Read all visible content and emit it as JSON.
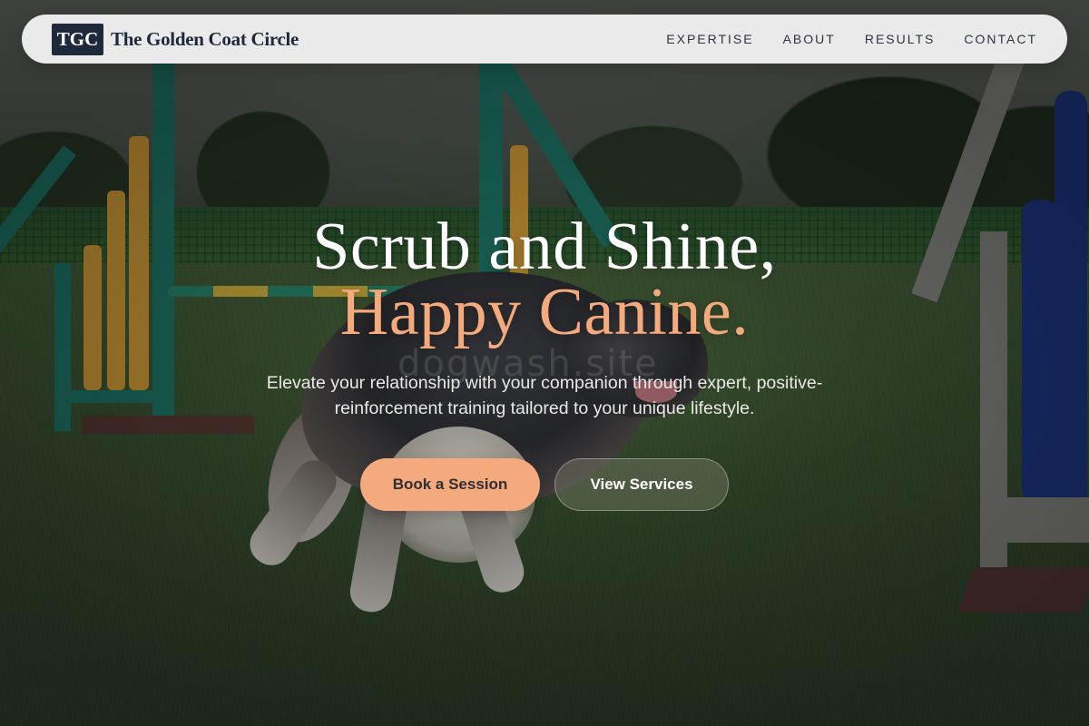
{
  "brand": {
    "logo_text": "TGC",
    "name": "The Golden Coat Circle"
  },
  "nav": {
    "items": [
      {
        "label": "EXPERTISE"
      },
      {
        "label": "ABOUT"
      },
      {
        "label": "RESULTS"
      },
      {
        "label": "CONTACT"
      }
    ]
  },
  "hero": {
    "headline_line1": "Scrub and Shine,",
    "headline_line2": "Happy Canine.",
    "subtext": "Elevate your relationship with your companion through expert, positive-reinforcement training tailored to your unique lifestyle.",
    "primary_cta": "Book a Session",
    "secondary_cta": "View Services",
    "watermark": "dogwash.site"
  },
  "colors": {
    "accent": "#f5aa7d",
    "brand_dark": "#1e2a3b",
    "nav_background": "#f8f8f8"
  }
}
